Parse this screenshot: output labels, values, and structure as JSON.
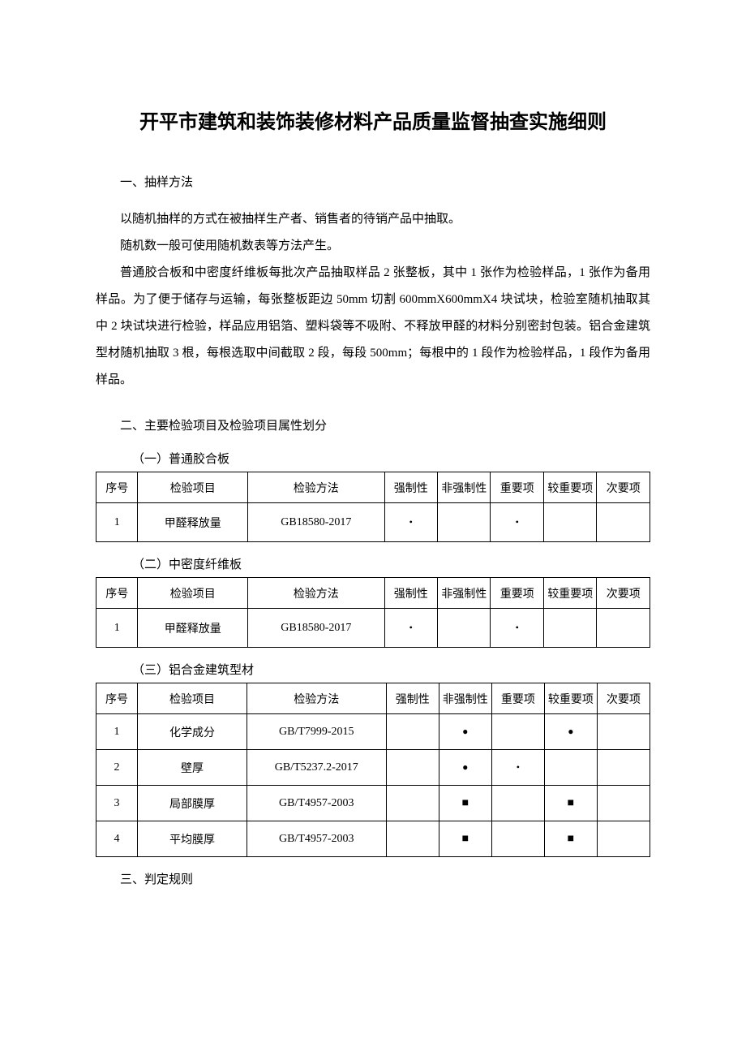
{
  "title": "开平市建筑和装饰装修材料产品质量监督抽查实施细则",
  "s1": {
    "heading": "一、抽样方法",
    "p1": "以随机抽样的方式在被抽样生产者、销售者的待销产品中抽取。",
    "p2": "随机数一般可使用随机数表等方法产生。",
    "p3": "普通胶合板和中密度纤维板每批次产品抽取样品 2 张整板，其中 1 张作为检验样品，1 张作为备用样品。为了便于储存与运输，每张整板距边 50mm 切割 600mmX600mmX4 块试块，检验室随机抽取其中 2 块试块进行检验，样品应用铝箔、塑料袋等不吸附、不释放甲醛的材料分别密封包装。铝合金建筑型材随机抽取 3 根，每根选取中间截取 2 段，每段 500mm；每根中的 1 段作为检验样品，1 段作为备用样品。"
  },
  "s2": {
    "heading": "二、主要检验项目及检验项目属性划分",
    "sub1": "（一）普通胶合板",
    "sub2": "（二）中密度纤维板",
    "sub3": "（三）铝合金建筑型材"
  },
  "th": {
    "seq": "序号",
    "item": "检验项目",
    "method": "检验方法",
    "c1": "强制性",
    "c2": "非强制性",
    "c3": "重要项",
    "c4": "较重要项",
    "c5": "次要项"
  },
  "t1": {
    "r1": {
      "seq": "1",
      "item": "甲醛释放量",
      "method": "GB18580-2017"
    }
  },
  "t2": {
    "r1": {
      "seq": "1",
      "item": "甲醛释放量",
      "method": "GB18580-2017"
    }
  },
  "t3": {
    "r1": {
      "seq": "1",
      "item": "化学成分",
      "method": "GB/T7999-2015"
    },
    "r2": {
      "seq": "2",
      "item": "壁厚",
      "method": "GB/T5237.2-2017"
    },
    "r3": {
      "seq": "3",
      "item": "局部膜厚",
      "method": "GB/T4957-2003"
    },
    "r4": {
      "seq": "4",
      "item": "平均膜厚",
      "method": "GB/T4957-2003"
    }
  },
  "s3": {
    "heading": "三、判定规则"
  }
}
